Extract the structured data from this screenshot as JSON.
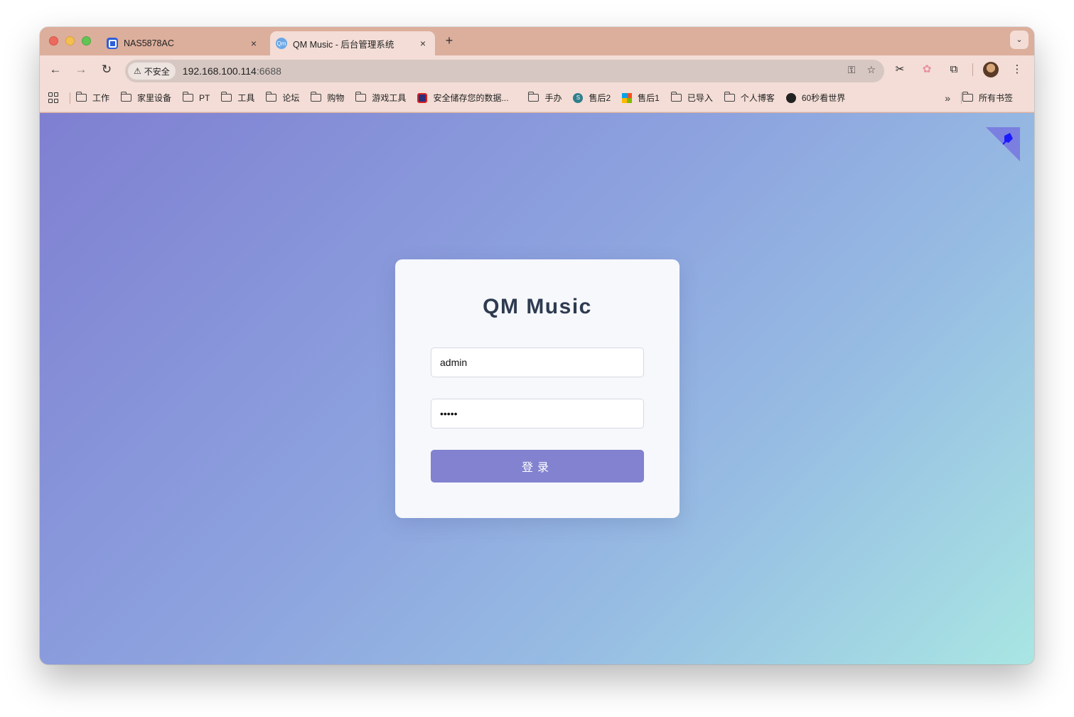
{
  "browser": {
    "tabs": [
      {
        "title": "NAS5878AC",
        "active": false
      },
      {
        "title": "QM Music - 后台管理系统",
        "active": true
      }
    ],
    "tab_close_glyph": "×",
    "new_tab_glyph": "+",
    "tab_menu_glyph": "⌄",
    "security_label": "不安全",
    "url_host": "192.168.100.114",
    "url_port": ":6688",
    "bookmarks": [
      {
        "label": "工作",
        "icon": "folder-icon"
      },
      {
        "label": "家里设备",
        "icon": "folder-icon"
      },
      {
        "label": "PT",
        "icon": "folder-icon"
      },
      {
        "label": "工具",
        "icon": "folder-icon"
      },
      {
        "label": "论坛",
        "icon": "folder-icon"
      },
      {
        "label": "购物",
        "icon": "folder-icon"
      },
      {
        "label": "游戏工具",
        "icon": "folder-icon"
      },
      {
        "label": "安全储存您的数据...",
        "icon": "site-favicon"
      },
      {
        "label": "手办",
        "icon": "folder-icon"
      },
      {
        "label": "售后2",
        "icon": "sharepoint-favicon"
      },
      {
        "label": "售后1",
        "icon": "microsoft-favicon"
      },
      {
        "label": "已导入",
        "icon": "folder-icon"
      },
      {
        "label": "个人博客",
        "icon": "folder-icon"
      },
      {
        "label": "60秒看世界",
        "icon": "site-favicon"
      }
    ],
    "all_bookmarks_label": "所有书签"
  },
  "login": {
    "title": "QM Music",
    "username_value": "admin",
    "password_value": "•••••",
    "submit_label": "登录"
  },
  "colors": {
    "tabstrip": "#dcae9c",
    "toolbar": "#f3ddd6",
    "gradient_start": "#7f7fd1",
    "gradient_end": "#a9e6e3",
    "button": "#8282d0",
    "title": "#2e3b50"
  }
}
